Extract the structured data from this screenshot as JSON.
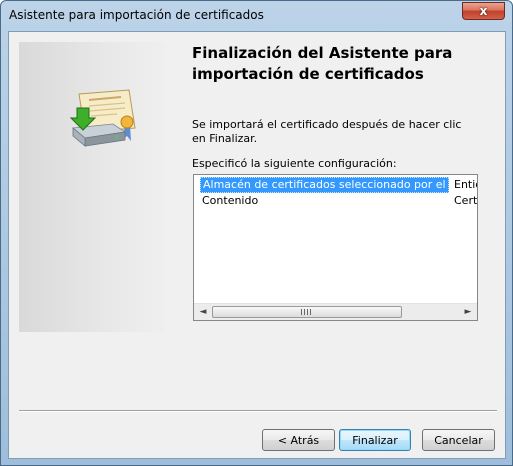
{
  "window": {
    "title": "Asistente para importación de certificados",
    "close_glyph": "x"
  },
  "header": {
    "title": "Finalización del Asistente para importación de certificados"
  },
  "content": {
    "description": "Se importará el certificado después de hacer clic en Finalizar.",
    "list_label": "Especificó la siguiente configuración:",
    "rows": [
      {
        "setting": "Almacén de certificados seleccionado por el usuario",
        "value": "Entid",
        "selected": true
      },
      {
        "setting": "Contenido",
        "value": "Certi",
        "selected": false
      }
    ]
  },
  "icons": {
    "illustration": "certificate-install-icon",
    "scroll_left": "scroll-left-arrow-icon",
    "scroll_right": "scroll-right-arrow-icon"
  },
  "scrollbar": {
    "left_arrow": "◄",
    "right_arrow": "►"
  },
  "buttons": {
    "back": "< Atrás",
    "finish": "Finalizar",
    "cancel": "Cancelar"
  },
  "colors": {
    "selection": "#3399ff",
    "title_bar": "#bcd3e8",
    "close_button": "#c2402a"
  }
}
